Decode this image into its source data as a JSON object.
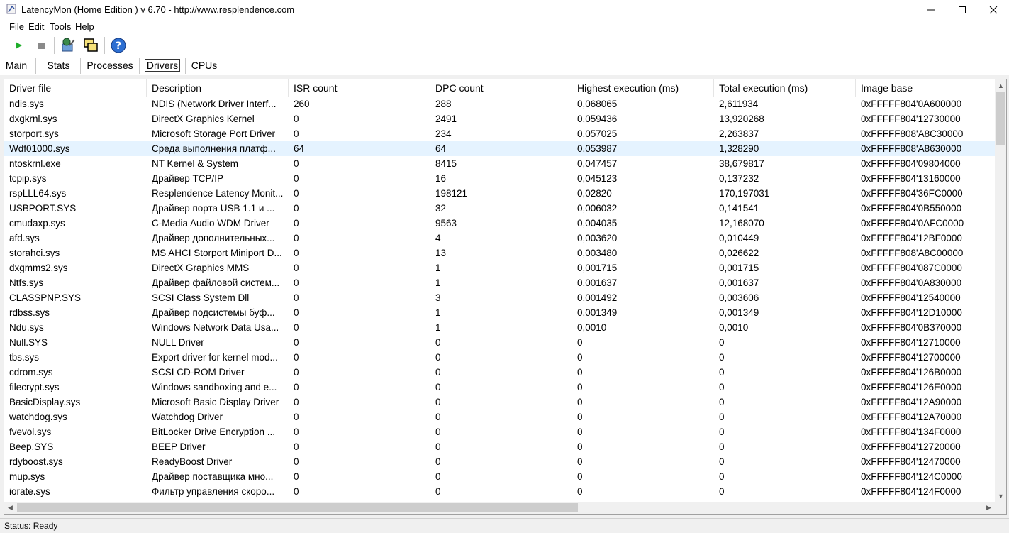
{
  "window": {
    "title": "LatencyMon  (Home Edition )  v 6.70 - http://www.resplendence.com"
  },
  "menu": [
    "File",
    "Edit",
    "Tools",
    "Help"
  ],
  "toolbar": {
    "icons": [
      "play-icon",
      "stop-icon",
      "monitor-network-icon",
      "windows-stack-icon",
      "help-icon"
    ]
  },
  "tabs": [
    {
      "label": "Main",
      "active": false
    },
    {
      "label": "Stats",
      "active": false
    },
    {
      "label": "Processes",
      "active": false
    },
    {
      "label": "Drivers",
      "active": true
    },
    {
      "label": "CPUs",
      "active": false
    }
  ],
  "table": {
    "columns": [
      "Driver file",
      "Description",
      "ISR count",
      "DPC count",
      "Highest execution (ms)",
      "Total execution (ms)",
      "Image base"
    ],
    "selected_row": 3,
    "rows": [
      [
        "ndis.sys",
        "NDIS (Network Driver Interf...",
        "260",
        "288",
        "0,068065",
        "2,611934",
        "0xFFFFF804'0A600000"
      ],
      [
        "dxgkrnl.sys",
        "DirectX Graphics Kernel",
        "0",
        "2491",
        "0,059436",
        "13,920268",
        "0xFFFFF804'12730000"
      ],
      [
        "storport.sys",
        "Microsoft Storage Port Driver",
        "0",
        "234",
        "0,057025",
        "2,263837",
        "0xFFFFF808'A8C30000"
      ],
      [
        "Wdf01000.sys",
        "Среда выполнения платф...",
        "64",
        "64",
        "0,053987",
        "1,328290",
        "0xFFFFF808'A8630000"
      ],
      [
        "ntoskrnl.exe",
        "NT Kernel & System",
        "0",
        "8415",
        "0,047457",
        "38,679817",
        "0xFFFFF804'09804000"
      ],
      [
        "tcpip.sys",
        "Драйвер TCP/IP",
        "0",
        "16",
        "0,045123",
        "0,137232",
        "0xFFFFF804'13160000"
      ],
      [
        "rspLLL64.sys",
        "Resplendence Latency Monit...",
        "0",
        "198121",
        "0,02820",
        "170,197031",
        "0xFFFFF804'36FC0000"
      ],
      [
        "USBPORT.SYS",
        "Драйвер порта USB 1.1 и ...",
        "0",
        "32",
        "0,006032",
        "0,141541",
        "0xFFFFF804'0B550000"
      ],
      [
        "cmudaxp.sys",
        "C-Media Audio WDM Driver",
        "0",
        "9563",
        "0,004035",
        "12,168070",
        "0xFFFFF804'0AFC0000"
      ],
      [
        "afd.sys",
        "Драйвер дополнительных...",
        "0",
        "4",
        "0,003620",
        "0,010449",
        "0xFFFFF804'12BF0000"
      ],
      [
        "storahci.sys",
        "MS AHCI Storport Miniport D...",
        "0",
        "13",
        "0,003480",
        "0,026622",
        "0xFFFFF808'A8C00000"
      ],
      [
        "dxgmms2.sys",
        "DirectX Graphics MMS",
        "0",
        "1",
        "0,001715",
        "0,001715",
        "0xFFFFF804'087C0000"
      ],
      [
        "Ntfs.sys",
        "Драйвер файловой систем...",
        "0",
        "1",
        "0,001637",
        "0,001637",
        "0xFFFFF804'0A830000"
      ],
      [
        "CLASSPNP.SYS",
        "SCSI Class System Dll",
        "0",
        "3",
        "0,001492",
        "0,003606",
        "0xFFFFF804'12540000"
      ],
      [
        "rdbss.sys",
        "Драйвер подсистемы буф...",
        "0",
        "1",
        "0,001349",
        "0,001349",
        "0xFFFFF804'12D10000"
      ],
      [
        "Ndu.sys",
        "Windows Network Data Usa...",
        "0",
        "1",
        "0,0010",
        "0,0010",
        "0xFFFFF804'0B370000"
      ],
      [
        "Null.SYS",
        "NULL Driver",
        "0",
        "0",
        "0",
        "0",
        "0xFFFFF804'12710000"
      ],
      [
        "tbs.sys",
        "Export driver for kernel mod...",
        "0",
        "0",
        "0",
        "0",
        "0xFFFFF804'12700000"
      ],
      [
        "cdrom.sys",
        "SCSI CD-ROM Driver",
        "0",
        "0",
        "0",
        "0",
        "0xFFFFF804'126B0000"
      ],
      [
        "filecrypt.sys",
        "Windows sandboxing and e...",
        "0",
        "0",
        "0",
        "0",
        "0xFFFFF804'126E0000"
      ],
      [
        "BasicDisplay.sys",
        "Microsoft Basic Display Driver",
        "0",
        "0",
        "0",
        "0",
        "0xFFFFF804'12A90000"
      ],
      [
        "watchdog.sys",
        "Watchdog Driver",
        "0",
        "0",
        "0",
        "0",
        "0xFFFFF804'12A70000"
      ],
      [
        "fvevol.sys",
        "BitLocker Drive Encryption ...",
        "0",
        "0",
        "0",
        "0",
        "0xFFFFF804'134F0000"
      ],
      [
        "Beep.SYS",
        "BEEP Driver",
        "0",
        "0",
        "0",
        "0",
        "0xFFFFF804'12720000"
      ],
      [
        "rdyboost.sys",
        "ReadyBoost Driver",
        "0",
        "0",
        "0",
        "0",
        "0xFFFFF804'12470000"
      ],
      [
        "mup.sys",
        "Драйвер поставщика мно...",
        "0",
        "0",
        "0",
        "0",
        "0xFFFFF804'124C0000"
      ],
      [
        "iorate.sys",
        "Фильтр управления скоро...",
        "0",
        "0",
        "0",
        "0",
        "0xFFFFF804'124F0000"
      ]
    ]
  },
  "status": {
    "text": "Status: Ready"
  }
}
